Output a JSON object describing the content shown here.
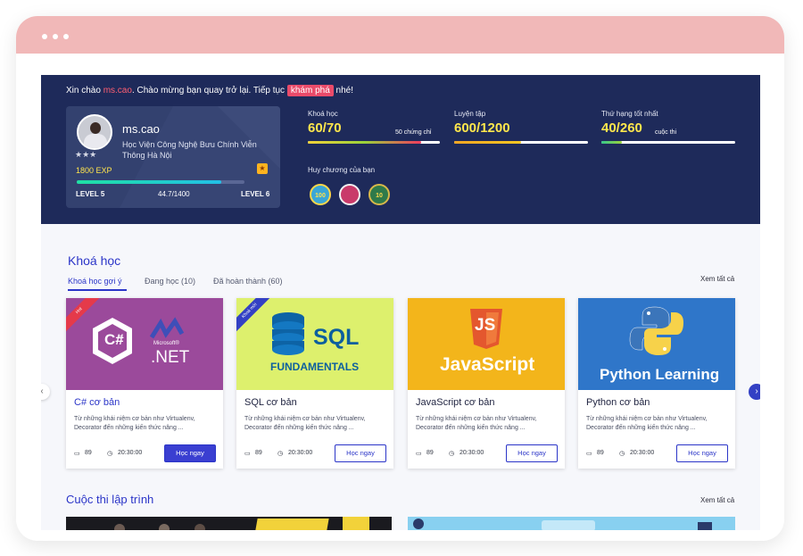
{
  "hero": {
    "greet_prefix": "Xin chào ",
    "greet_user": "ms.cao",
    "greet_middle": ". Chào mừng bạn quay trở lại. Tiếp tục ",
    "greet_link": "khám phá",
    "greet_suffix": " nhé!"
  },
  "profile": {
    "name": "ms.cao",
    "school": "Học Viện Công Nghệ Bưu Chính Viễn Thông Hà Nội",
    "stars": "★★★",
    "exp": "1800 EXP",
    "level_current": "LEVEL 5",
    "level_next": "LEVEL 6",
    "xp_progress_text": "44.7/1400",
    "xp_progress_fraction": 0.86
  },
  "stats": {
    "courses_label": "Khoá học",
    "courses_value": "60/70",
    "courses_sub": "50 chứng chỉ",
    "courses_fraction": 0.86,
    "practice_label": "Luyện tập",
    "practice_value": "600/1200",
    "practice_fraction": 0.5,
    "rank_label": "Thứ hạng tốt nhất",
    "rank_value": "40/260",
    "rank_sub": "cuộc thi",
    "rank_fraction": 0.15,
    "colors": {
      "courses": "#f03a5e",
      "practice": "#f5a623",
      "rank": "#36c78b"
    }
  },
  "medals": {
    "title": "Huy chương của bạn",
    "items": [
      {
        "text": "100"
      },
      {
        "text": ""
      },
      {
        "text": "10"
      }
    ]
  },
  "courses_section": {
    "title": "Khoá học",
    "see_all": "Xem tất cả",
    "tabs": [
      "Khoá học gợi ý",
      "Đang học (10)",
      "Đã hoàn thành (60)"
    ],
    "cards": [
      {
        "title": "C# cơ bản",
        "desc": "Từ những khái niệm cơ bản như Virtualenv, Decorator đến những kiến thức nâng ...",
        "lessons": "89",
        "duration": "20:30:00",
        "button": "Học ngay",
        "ribbon": "Hot",
        "thumb_bg": "#9b4a9b",
        "logo_a": "C#",
        "logo_b": "Microsoft®",
        "logo_c": ".NET"
      },
      {
        "title": "SQL cơ bản",
        "desc": "Từ những khái niệm cơ bản như Virtualenv, Decorator đến những kiến thức nâng ...",
        "lessons": "89",
        "duration": "20:30:00",
        "button": "Học ngay",
        "ribbon": "Khoá mới",
        "thumb_bg": "#ddf06d",
        "logo_a": "SQL",
        "logo_b": "FUNDAMENTALS"
      },
      {
        "title": "JavaScript cơ bản",
        "desc": "Từ những khái niệm cơ bản như Virtualenv, Decorator đến những kiến thức nâng ...",
        "lessons": "89",
        "duration": "20:30:00",
        "button": "Học ngay",
        "thumb_bg": "#f3b51b",
        "logo_a": "JS",
        "logo_b": "JavaScript"
      },
      {
        "title": "Python cơ bản",
        "desc": "Từ những khái niệm cơ bản như Virtualenv, Decorator đến những kiến thức nâng ...",
        "lessons": "89",
        "duration": "20:30:00",
        "button": "Học ngay",
        "thumb_bg": "#2f76c9",
        "logo_a": "Python Learning"
      }
    ]
  },
  "contests_section": {
    "title": "Cuộc thi lập trình",
    "see_all": "Xem tất cả"
  }
}
